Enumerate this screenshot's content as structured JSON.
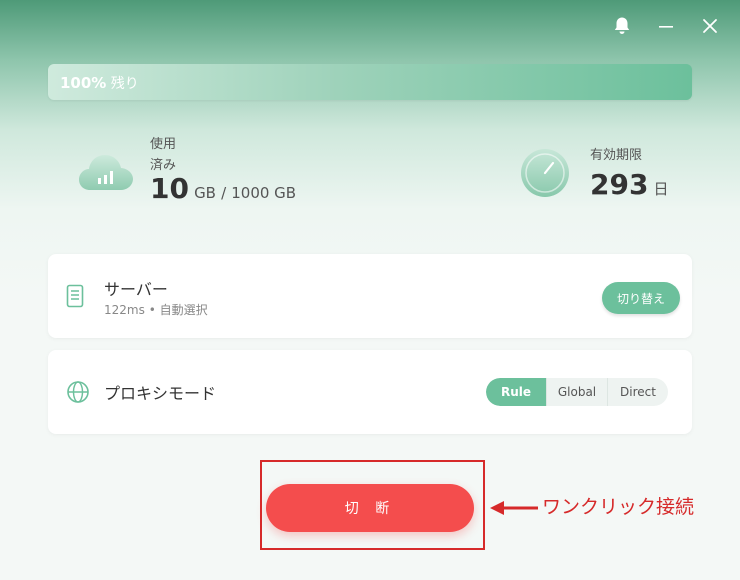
{
  "colors": {
    "accent": "#6cc09c",
    "header": "#4e9a78",
    "danger": "#f44d4d",
    "annotation": "#d62a2a"
  },
  "titlebar": {
    "icons": [
      "bell-icon",
      "minimize-icon",
      "close-icon"
    ]
  },
  "quota": {
    "percent_label": "100%",
    "remaining_label": "残り",
    "fill_percent": 100
  },
  "usage": {
    "label_line1": "使用",
    "label_line2": "済み",
    "used": "10",
    "used_unit": "GB",
    "separator": "/",
    "total": "1000 GB"
  },
  "expiry": {
    "label": "有効期限",
    "days": "293",
    "days_unit": "日"
  },
  "server": {
    "title": "サーバー",
    "latency": "122ms",
    "dot": "•",
    "selection": "自動選択",
    "switch_label": "切り替え"
  },
  "proxy": {
    "title": "プロキシモード",
    "modes": [
      "Rule",
      "Global",
      "Direct"
    ],
    "selected": "Rule"
  },
  "action": {
    "disconnect_label": "切 断"
  },
  "annotation": {
    "text": "ワンクリック接続"
  }
}
